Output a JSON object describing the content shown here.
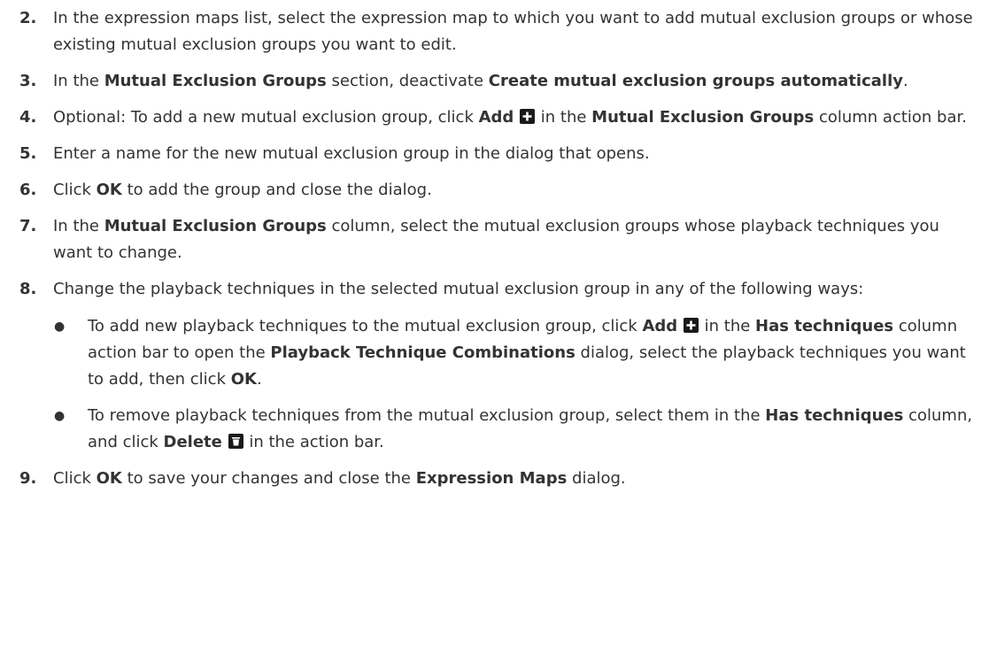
{
  "steps": [
    {
      "num": "2.",
      "parts": [
        {
          "t": "In the expression maps list, select the expression map to which you want to add mutual exclusion groups or whose existing mutual exclusion groups you want to edit."
        }
      ]
    },
    {
      "num": "3.",
      "parts": [
        {
          "t": "In the "
        },
        {
          "b": "Mutual Exclusion Groups"
        },
        {
          "t": " section, deactivate "
        },
        {
          "b": "Create mutual exclusion groups automatically"
        },
        {
          "t": "."
        }
      ]
    },
    {
      "num": "4.",
      "parts": [
        {
          "t": "Optional: To add a new mutual exclusion group, click "
        },
        {
          "b": "Add"
        },
        {
          "t": " "
        },
        {
          "icon": "add-icon"
        },
        {
          "t": " in the "
        },
        {
          "b": "Mutual Exclusion Groups"
        },
        {
          "t": " column action bar."
        }
      ]
    },
    {
      "num": "5.",
      "parts": [
        {
          "t": "Enter a name for the new mutual exclusion group in the dialog that opens."
        }
      ]
    },
    {
      "num": "6.",
      "parts": [
        {
          "t": "Click "
        },
        {
          "b": "OK"
        },
        {
          "t": " to add the group and close the dialog."
        }
      ]
    },
    {
      "num": "7.",
      "parts": [
        {
          "t": "In the "
        },
        {
          "b": "Mutual Exclusion Groups"
        },
        {
          "t": " column, select the mutual exclusion groups whose playback techniques you want to change."
        }
      ]
    },
    {
      "num": "8.",
      "parts": [
        {
          "t": "Change the playback techniques in the selected mutual exclusion group in any of the following ways:"
        }
      ],
      "subs": [
        {
          "bullet": "●",
          "parts": [
            {
              "t": "To add new playback techniques to the mutual exclusion group, click "
            },
            {
              "b": "Add"
            },
            {
              "t": " "
            },
            {
              "icon": "add-icon"
            },
            {
              "t": " in the "
            },
            {
              "b": "Has techniques"
            },
            {
              "t": " column action bar to open the "
            },
            {
              "b": "Playback Technique Combinations"
            },
            {
              "t": " dialog, select the playback techniques you want to add, then click "
            },
            {
              "b": "OK"
            },
            {
              "t": "."
            }
          ]
        },
        {
          "bullet": "●",
          "parts": [
            {
              "t": "To remove playback techniques from the mutual exclusion group, select them in the "
            },
            {
              "b": "Has techniques"
            },
            {
              "t": " column, and click "
            },
            {
              "b": "Delete"
            },
            {
              "t": " "
            },
            {
              "icon": "delete-icon"
            },
            {
              "t": " in the action bar."
            }
          ]
        }
      ]
    },
    {
      "num": "9.",
      "parts": [
        {
          "t": "Click "
        },
        {
          "b": "OK"
        },
        {
          "t": " to save your changes and close the "
        },
        {
          "b": "Expression Maps"
        },
        {
          "t": " dialog."
        }
      ]
    }
  ]
}
